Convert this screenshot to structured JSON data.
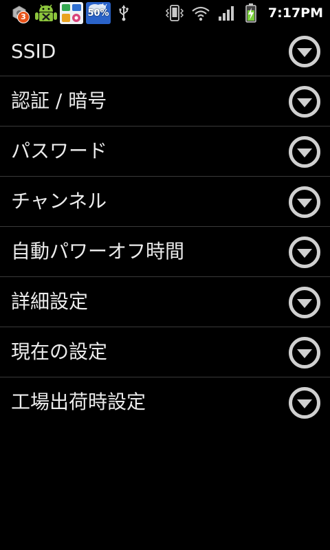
{
  "status_bar": {
    "notification_count": "3",
    "weather_percent": "50%",
    "time": "7:17PM",
    "icons": {
      "left": [
        "settings-notification-icon",
        "android-app-icon",
        "photo-app-icon",
        "weather-icon",
        "usb-icon"
      ],
      "right": [
        "vibrate-icon",
        "wifi-icon",
        "signal-icon",
        "battery-charging-icon"
      ]
    },
    "colors": {
      "badge": "#e8531a",
      "android_green": "#8cc43c",
      "battery_green": "#7ad13a"
    }
  },
  "menu": {
    "items": [
      {
        "label": "SSID"
      },
      {
        "label": "認証 / 暗号"
      },
      {
        "label": "パスワード"
      },
      {
        "label": "チャンネル"
      },
      {
        "label": "自動パワーオフ時間"
      },
      {
        "label": "詳細設定"
      },
      {
        "label": "現在の設定"
      },
      {
        "label": "工場出荷時設定"
      }
    ],
    "expand_icon": "chevron-down-circle-icon"
  }
}
